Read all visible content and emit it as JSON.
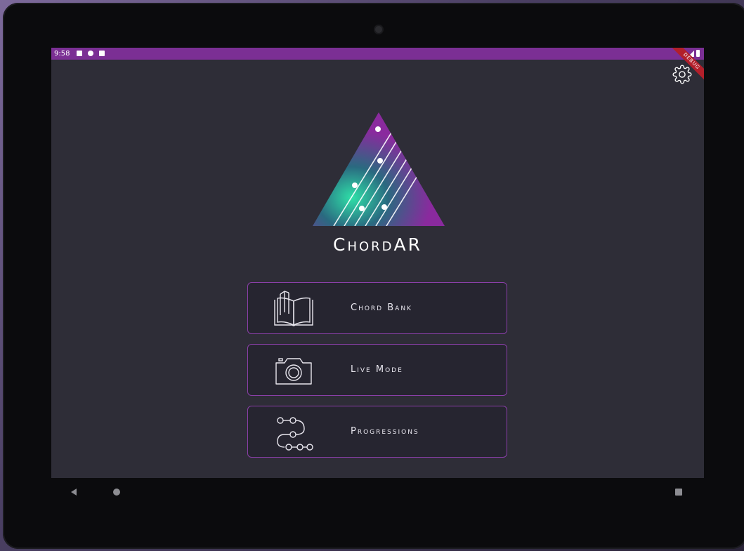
{
  "status_bar": {
    "time": "9:58",
    "debug_label": "DEBUG",
    "color": "#7b2f94"
  },
  "app": {
    "title": "ChordAR",
    "background": "#2e2d37",
    "accent": "#8a3fa8"
  },
  "menu": [
    {
      "label": "Chord Bank",
      "icon": "book-icon"
    },
    {
      "label": "Live Mode",
      "icon": "camera-icon"
    },
    {
      "label": "Progressions",
      "icon": "progression-icon"
    }
  ],
  "icons": {
    "settings": "gear-icon",
    "logo": "triangle-strings-logo"
  },
  "nav": {
    "back": "back-icon",
    "home": "home-icon",
    "recents": "recents-icon"
  }
}
